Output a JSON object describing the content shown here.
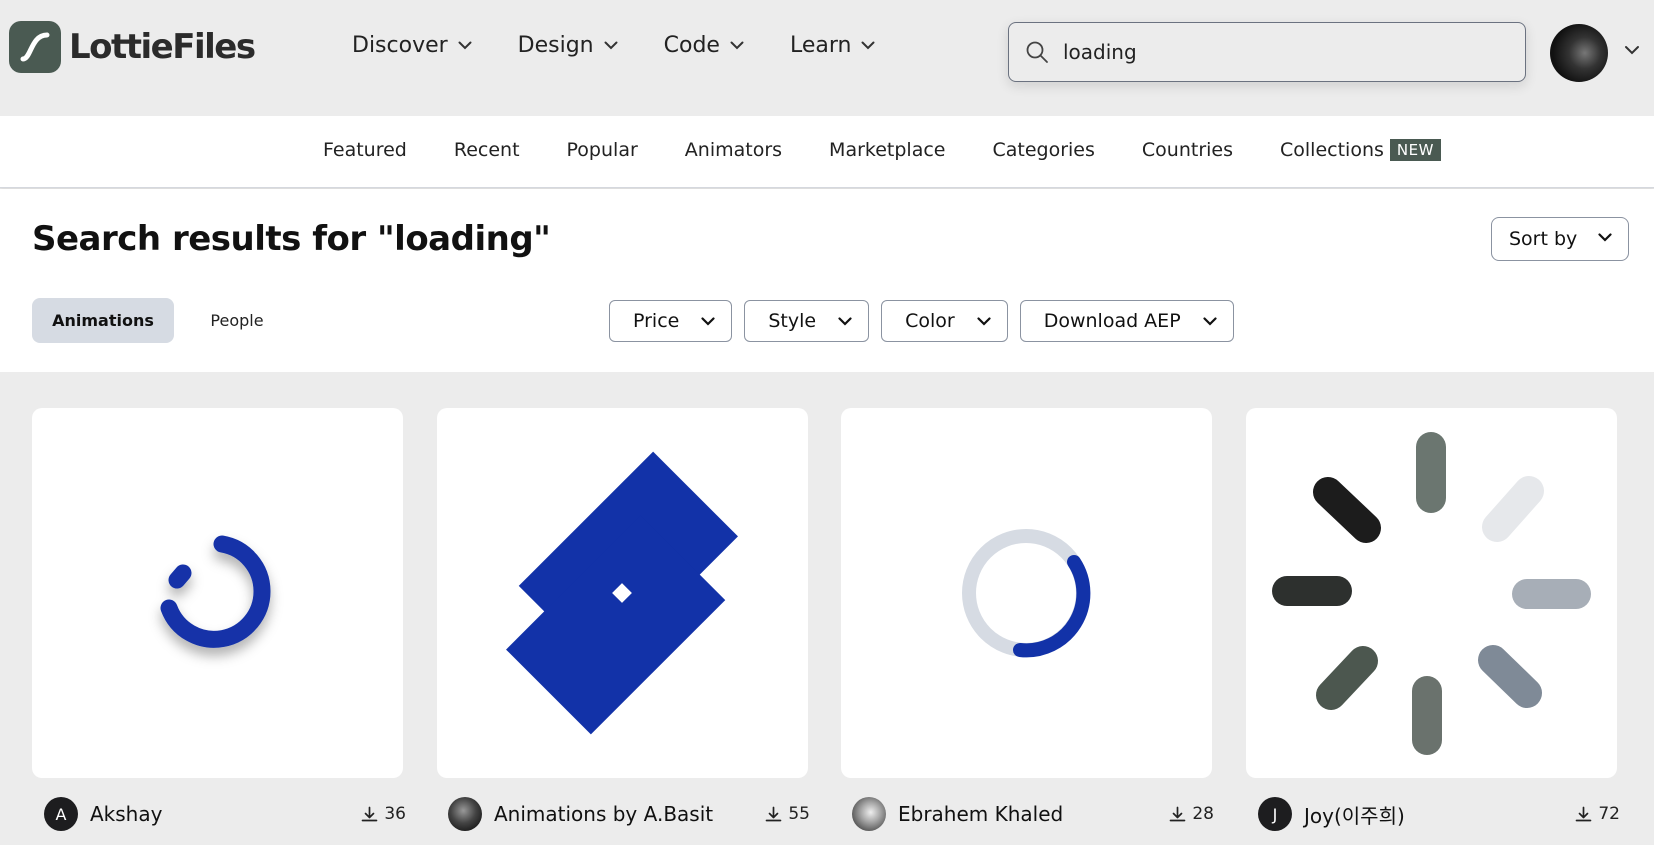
{
  "brand": {
    "name": "LottieFiles",
    "logo_color": "#4a5a52"
  },
  "mainnav": {
    "items": [
      {
        "label": "Discover",
        "icon": "chevron-down-icon"
      },
      {
        "label": "Design",
        "icon": "chevron-down-icon"
      },
      {
        "label": "Code",
        "icon": "chevron-down-icon"
      },
      {
        "label": "Learn",
        "icon": "chevron-down-icon"
      }
    ]
  },
  "search": {
    "value": "loading",
    "icon": "search-icon"
  },
  "subnav": {
    "items": [
      "Featured",
      "Recent",
      "Popular",
      "Animators",
      "Marketplace",
      "Categories",
      "Countries",
      "Collections"
    ],
    "badge": "NEW"
  },
  "results": {
    "title": "Search results for \"loading\"",
    "sort_label": "Sort by",
    "tabs": [
      {
        "label": "Animations",
        "active": true
      },
      {
        "label": "People",
        "active": false
      }
    ],
    "filters": [
      "Price",
      "Style",
      "Color",
      "Download AEP"
    ]
  },
  "cards": [
    {
      "author": "Akshay",
      "avatar_initial": "A",
      "downloads": "36",
      "preview": "spinner-arc"
    },
    {
      "author": "Animations by A.Basit",
      "avatar_initial": "",
      "downloads": "55",
      "preview": "crossed-squares"
    },
    {
      "author": "Ebrahem Khaled",
      "avatar_initial": "",
      "downloads": "28",
      "preview": "ring-progress"
    },
    {
      "author": "Joy(이주희)",
      "avatar_initial": "J",
      "downloads": "72",
      "preview": "radial-spinner"
    }
  ],
  "colors": {
    "accent_blue": "#1232a8",
    "badge_bg": "#4a5a52",
    "tab_active_bg": "#d6dbe3"
  }
}
